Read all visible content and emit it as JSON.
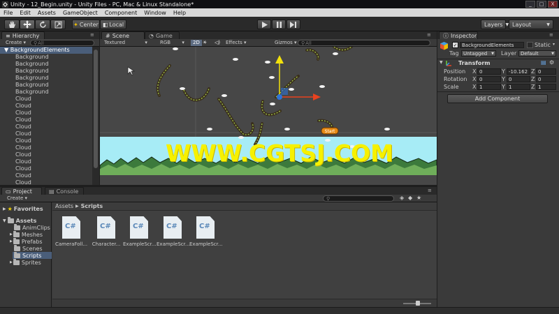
{
  "window": {
    "title": "Unity - 12_Begin.unity - Unity Files - PC, Mac & Linux Standalone*",
    "min": "_",
    "max": "□",
    "close": "X"
  },
  "menu": [
    "File",
    "Edit",
    "Assets",
    "GameObject",
    "Component",
    "Window",
    "Help"
  ],
  "toolbar": {
    "center_label": "Center",
    "local_label": "Local",
    "layers_label": "Layers",
    "layout_label": "Layout"
  },
  "hierarchy": {
    "tab": "Hierarchy",
    "create": "Create",
    "search_placeholder": "All",
    "items": [
      "BackgroundElements",
      "Background",
      "Background",
      "Background",
      "Background",
      "Background",
      "Background",
      "Cloud",
      "Cloud",
      "Cloud",
      "Cloud",
      "Cloud",
      "Cloud",
      "Cloud",
      "Cloud",
      "Cloud",
      "Cloud",
      "Cloud",
      "Cloud",
      "Cloud"
    ]
  },
  "scene": {
    "tab_scene": "Scene",
    "tab_game": "Game",
    "shading": "Textured",
    "render": "RGB",
    "mode_2d": "2D",
    "effects": "Effects",
    "gizmos": "Gizmos",
    "search_placeholder": "All",
    "start_button": "Start"
  },
  "inspector": {
    "tab": "Inspector",
    "object_name": "BackgroundElements",
    "static_label": "Static",
    "tag_label": "Tag",
    "tag_value": "Untagged",
    "layer_label": "Layer",
    "layer_value": "Default",
    "transform_label": "Transform",
    "position": {
      "label": "Position",
      "x": "0",
      "y": "-10.162",
      "z": "0"
    },
    "rotation": {
      "label": "Rotation",
      "x": "0",
      "y": "0",
      "z": "0"
    },
    "scale": {
      "label": "Scale",
      "x": "1",
      "y": "1",
      "z": "1"
    },
    "add_component": "Add Component"
  },
  "project": {
    "tab_project": "Project",
    "tab_console": "Console",
    "create": "Create",
    "favorites": "Favorites",
    "assets": "Assets",
    "folders": [
      "AnimClips",
      "Meshes",
      "Prefabs",
      "Scenes",
      "Scripts",
      "Sprites"
    ],
    "breadcrumb_root": "Assets",
    "breadcrumb_current": "Scripts",
    "files": [
      "CameraFoll...",
      "Character...",
      "ExampleScr...",
      "ExampleScr...",
      "ExampleScr..."
    ],
    "file_icon_text": "C#"
  },
  "watermark": "WWW.CGTSJ.COM",
  "colors": {
    "sky": "#a7ecf6",
    "grass_dark": "#3c7a3c",
    "grass_light": "#6fae5a",
    "axis_y": "#f2e10c",
    "axis_x": "#e8421f",
    "axis_center": "#2f73d6",
    "selection": "#4a5e7a"
  }
}
